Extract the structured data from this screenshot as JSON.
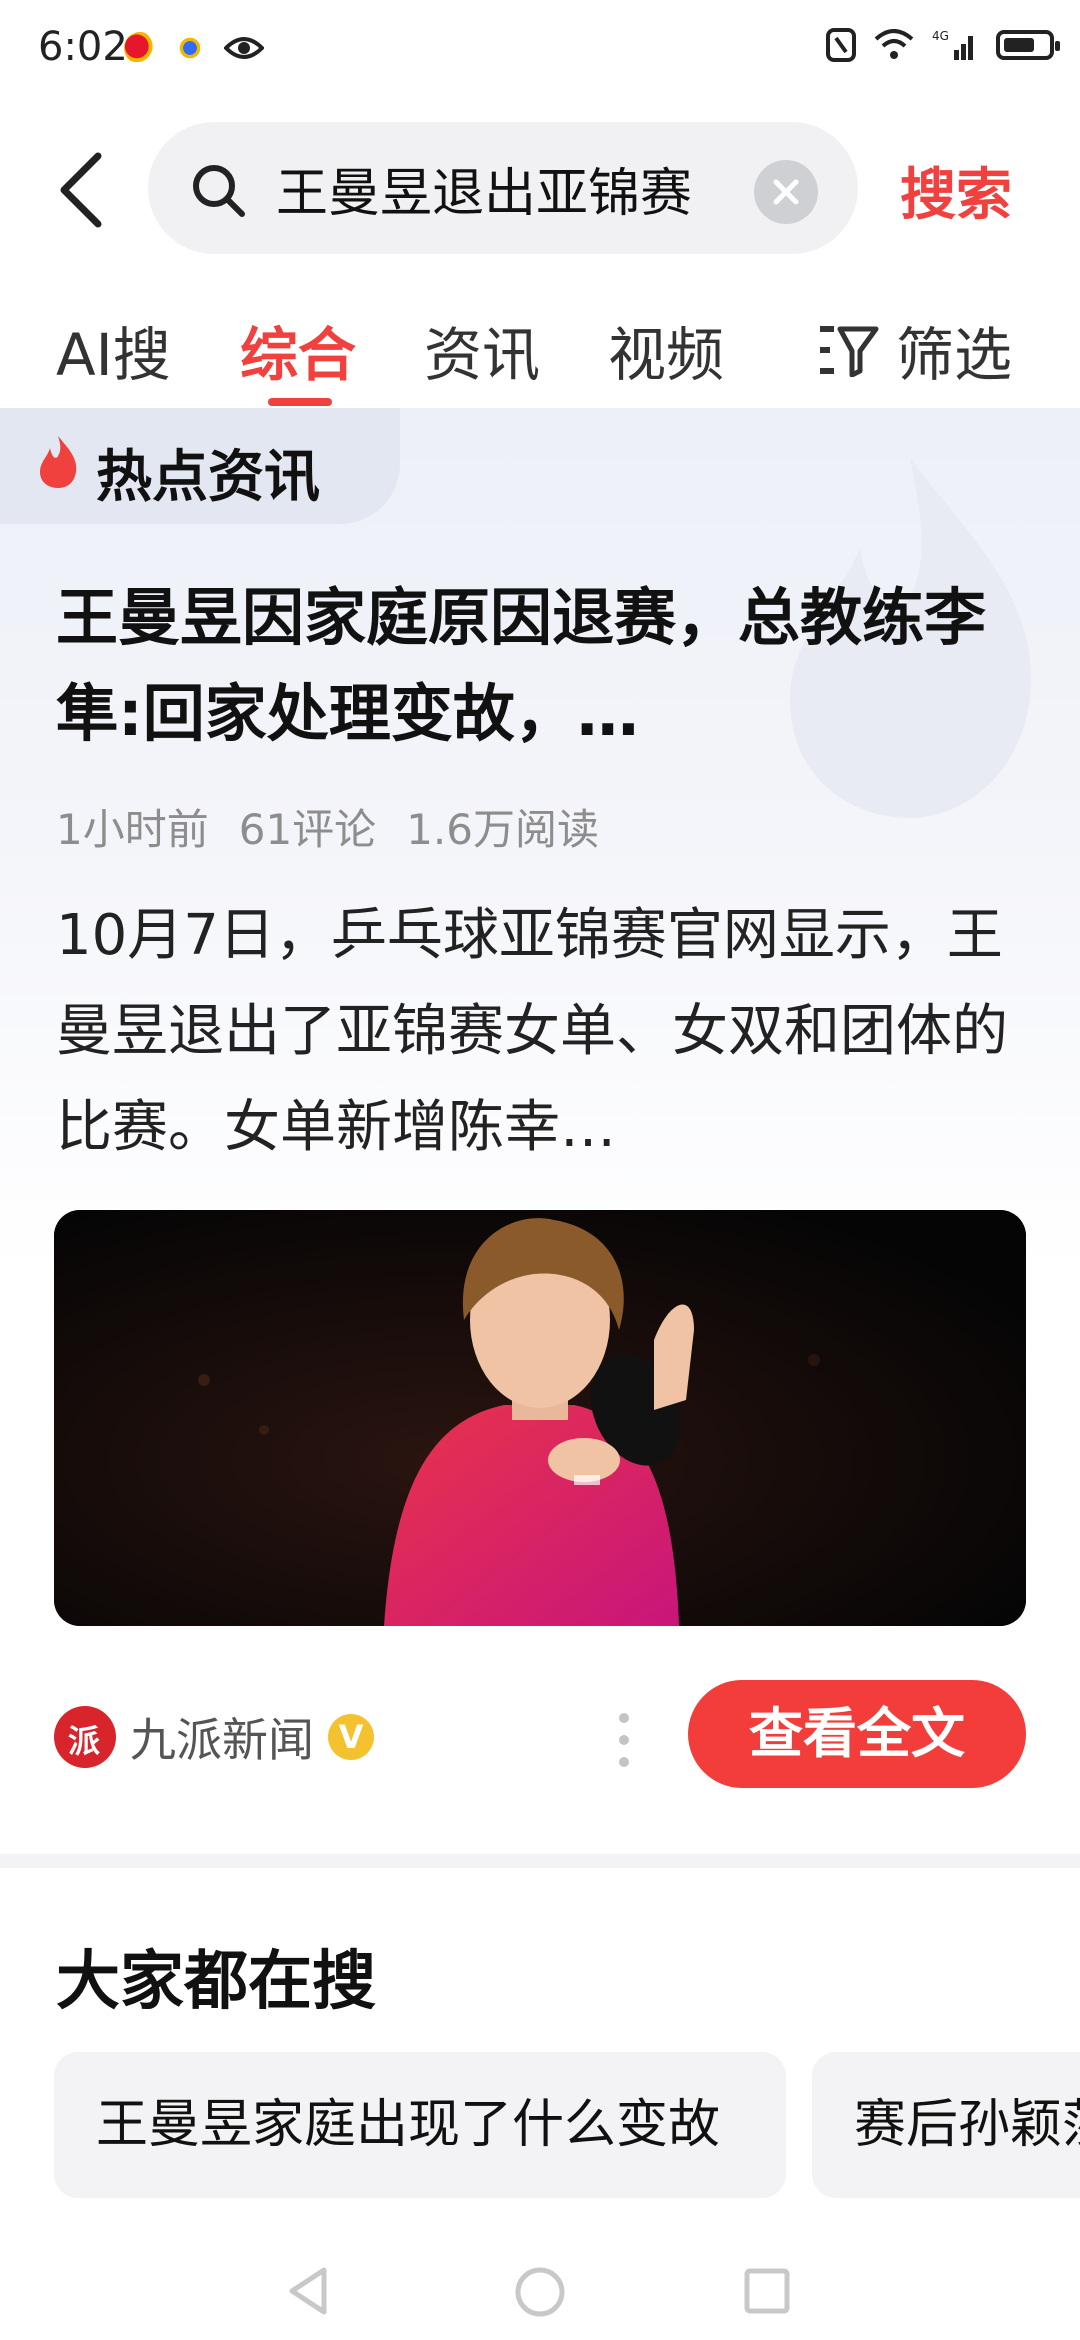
{
  "status": {
    "time": "6:02",
    "network": "4G"
  },
  "search": {
    "query": "王曼昱退出亚锦赛",
    "button": "搜索"
  },
  "tabs": [
    {
      "label": "AI搜"
    },
    {
      "label": "综合",
      "active": true
    },
    {
      "label": "资讯"
    },
    {
      "label": "视频"
    }
  ],
  "filter_label": "筛选",
  "hot": {
    "section_label": "热点资讯",
    "headline": "王曼昱因家庭原因退赛，总教练李隼:回家处理变故，…",
    "meta": {
      "time": "1小时前",
      "comments": "61评论",
      "reads": "1.6万阅读"
    },
    "summary": "10月7日，乒乓球亚锦赛官网显示，王曼昱退出了亚锦赛女单、女双和团体的比赛。女单新增陈幸…",
    "source": "九派新闻",
    "verified": "V",
    "read_full": "查看全文",
    "logo_char": "派"
  },
  "everyone_searching": {
    "title": "大家都在搜",
    "items": [
      "王曼昱家庭出现了什么变故",
      "赛后孙颖莎"
    ]
  },
  "colors": {
    "accent": "#f0413f",
    "button": "#f23d3a"
  }
}
